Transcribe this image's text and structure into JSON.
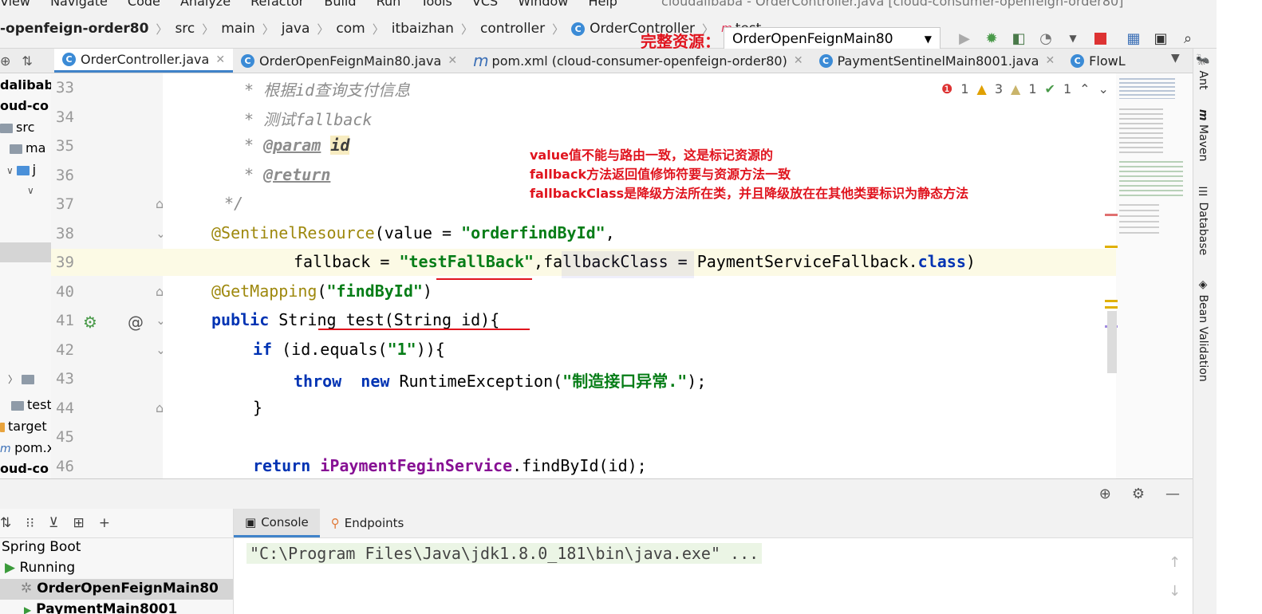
{
  "menu": {
    "items": [
      "View",
      "Navigate",
      "Code",
      "Analyze",
      "Refactor",
      "Build",
      "Run",
      "Tools",
      "VCS",
      "Window",
      "Help"
    ],
    "window_title": "cloudalibaba - OrderController.java [cloud-consumer-openfeign-order80]"
  },
  "breadcrumbs": [
    "-openfeign-order80",
    "src",
    "main",
    "java",
    "com",
    "itbaizhan",
    "controller",
    "OrderController",
    "test"
  ],
  "overlay_watermark": "完整资源：",
  "run_config": {
    "label": "OrderOpenFeignMain80"
  },
  "tabs": [
    {
      "label": "OrderController.java",
      "active": true
    },
    {
      "label": "OrderOpenFeignMain80.java",
      "active": false
    },
    {
      "label": "pom.xml (cloud-consumer-openfeign-order80)",
      "active": false
    },
    {
      "label": "PaymentSentinelMain8001.java",
      "active": false
    },
    {
      "label": "FlowL",
      "active": false
    }
  ],
  "project_tree": [
    "dalibab",
    "oud-co",
    "src",
    "ma",
    "j",
    "test",
    "target",
    "pom.x",
    "oud-co"
  ],
  "inspections": {
    "errors": "1",
    "warnings": "3",
    "weak": "1",
    "ok": "1"
  },
  "line_numbers": [
    "33",
    "34",
    "35",
    "36",
    "37",
    "38",
    "39",
    "40",
    "41",
    "42",
    "43",
    "44",
    "45",
    "46"
  ],
  "code": {
    "l33": "* 根据id查询支付信息",
    "l34": "* 测试fallback",
    "l35_star": "* ",
    "l35_tag": "@param",
    "l35_id": "id",
    "l36_star": "* ",
    "l36_tag": "@return",
    "l37": "*/",
    "l38_ann": "@SentinelResource",
    "l38_a": "(value = ",
    "l38_str": "\"orderfindById\"",
    "l38_b": ",",
    "l39_a": "fallback = ",
    "l39_str": "\"testFallBack\"",
    "l39_b": ",fallbackClass = PaymentServiceFallback.",
    "l39_kw": "class",
    "l39_c": ")",
    "l40_ann": "@GetMapping",
    "l40_a": "(",
    "l40_str": "\"findById\"",
    "l40_b": ")",
    "l41_kw": "public ",
    "l41_a": "String test(String id){",
    "l42_kw": "if ",
    "l42_a": "(id.equals(",
    "l42_str": "\"1\"",
    "l42_b": ")){",
    "l43_kw": "throw  new ",
    "l43_a": "RuntimeException(",
    "l43_str": "\"制造接口异常.\"",
    "l43_b": ");",
    "l44": "}",
    "l46_kw": "return ",
    "l46_fld": "iPaymentFeginService",
    "l46_a": ".findById(id);"
  },
  "annotation_note": [
    "value值不能与路由一致，这是标记资源的",
    "fallback方法返回值修饰符要与资源方法一致",
    "fallbackClass是降级方法所在类，并且降级放在在其他类要标识为静态方法"
  ],
  "right_tools": [
    "Ant",
    "Maven",
    "Database",
    "Bean Validation"
  ],
  "bottom": {
    "tabs": [
      "Console",
      "Endpoints"
    ],
    "tree": [
      "Spring Boot",
      "Running",
      "OrderOpenFeignMain80",
      "PaymentMain8001"
    ],
    "console_line": "\"C:\\Program Files\\Java\\jdk1.8.0_181\\bin\\java.exe\" ..."
  },
  "colors": {
    "accent": "#4083c9",
    "annotation_red": "#e0141e",
    "string_green": "#067d17",
    "keyword_blue": "#0033b3"
  }
}
